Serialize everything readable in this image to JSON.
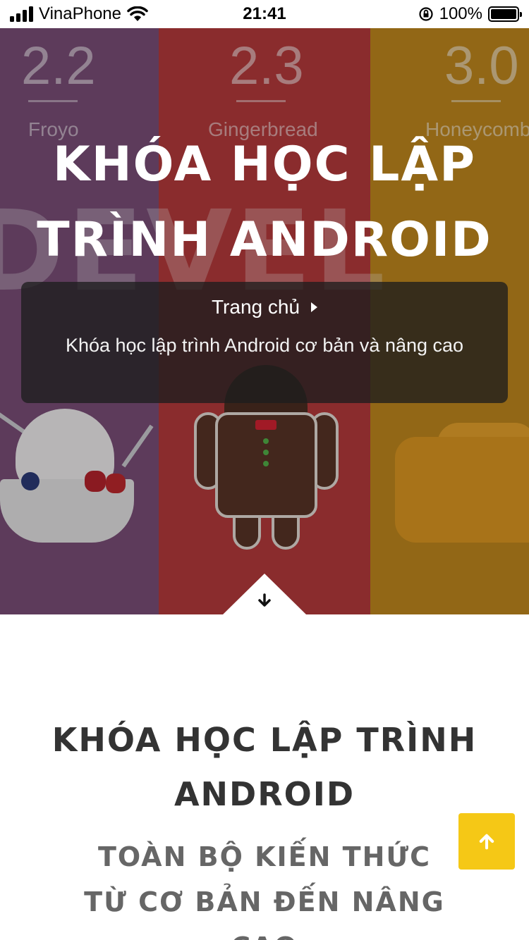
{
  "status_bar": {
    "carrier": "VinaPhone",
    "time": "21:41",
    "battery": "100%"
  },
  "hero": {
    "bg": {
      "panels": [
        {
          "version": "2.2",
          "name": "Froyo"
        },
        {
          "version": "2.3",
          "name": "Gingerbread"
        },
        {
          "version": "3.0",
          "name": "Honeycomb"
        }
      ],
      "big_word": "DEVEL"
    },
    "title_line1": "KHÓA HỌC LẬP",
    "title_line2": "TRÌNH ANDROID",
    "breadcrumb": {
      "home": "Trang chủ",
      "current": "Khóa học lập trình Android cơ bản và nâng cao"
    }
  },
  "content": {
    "title_line1": "KHÓA HỌC LẬP TRÌNH",
    "title_line2": "ANDROID",
    "subtitle_line1": "TOÀN BỘ KIẾN THỨC",
    "subtitle_line2": "TỪ CƠ BẢN ĐẾN NÂNG",
    "subtitle_line3": "CAO"
  },
  "colors": {
    "accent": "#f5c816",
    "froyo": "#7c4f7a",
    "gingerbread": "#b93b3c",
    "honeycomb": "#c38a1e"
  },
  "icons": [
    "signal-icon",
    "wifi-icon",
    "orientation-lock-icon",
    "battery-icon",
    "chevron-right-icon",
    "arrow-down-icon",
    "arrow-up-icon"
  ]
}
